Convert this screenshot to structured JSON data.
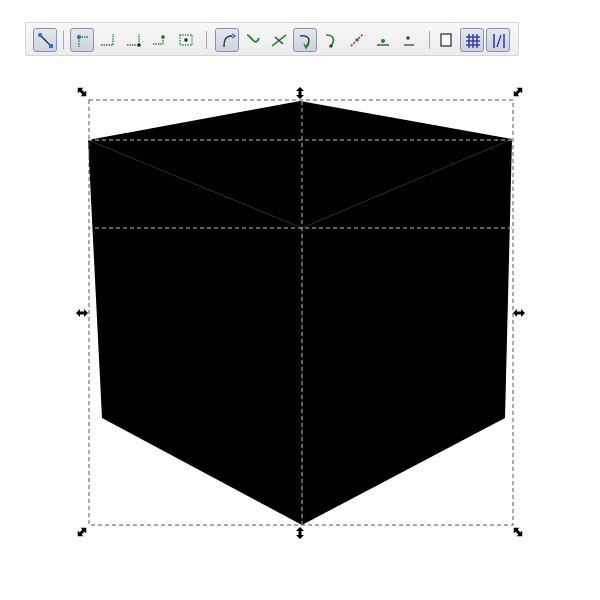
{
  "toolbar": {
    "groups": [
      {
        "name": "snap-toggle",
        "buttons": [
          {
            "icon": "snap-enable-icon",
            "active": true
          }
        ]
      },
      {
        "name": "bbox-snapping",
        "buttons": [
          {
            "icon": "snap-bbox-corner-icon",
            "active": true
          },
          {
            "icon": "snap-bbox-edge-icon",
            "active": false
          },
          {
            "icon": "snap-bbox-edge-midpoint-icon",
            "active": false
          },
          {
            "icon": "snap-bbox-corner-midpoint-icon",
            "active": false
          },
          {
            "icon": "snap-bbox-center-icon",
            "active": false
          }
        ]
      },
      {
        "name": "node-snapping",
        "buttons": [
          {
            "icon": "snap-nodes-icon",
            "active": true
          },
          {
            "icon": "snap-paths-icon",
            "active": false
          },
          {
            "icon": "snap-path-intersections-icon",
            "active": false
          },
          {
            "icon": "snap-cusp-nodes-icon",
            "active": true
          },
          {
            "icon": "snap-smooth-nodes-icon",
            "active": false
          },
          {
            "icon": "snap-line-midpoints-icon",
            "active": false
          },
          {
            "icon": "snap-object-center-icon",
            "active": false
          },
          {
            "icon": "snap-rotation-center-icon",
            "active": false
          }
        ]
      },
      {
        "name": "other-snapping",
        "buttons": [
          {
            "icon": "snap-page-border-icon",
            "active": false
          },
          {
            "icon": "snap-grid-icon",
            "active": true
          },
          {
            "icon": "snap-guides-icon",
            "active": true
          }
        ]
      }
    ]
  },
  "colors": {
    "cube_fill": "#000000",
    "node_green": "#1a8a2a",
    "node_red": "#cc2222",
    "selection_dash": "#555555",
    "guide_dash": "#bbbbbb",
    "grid_blue": "#1a2aa8"
  }
}
